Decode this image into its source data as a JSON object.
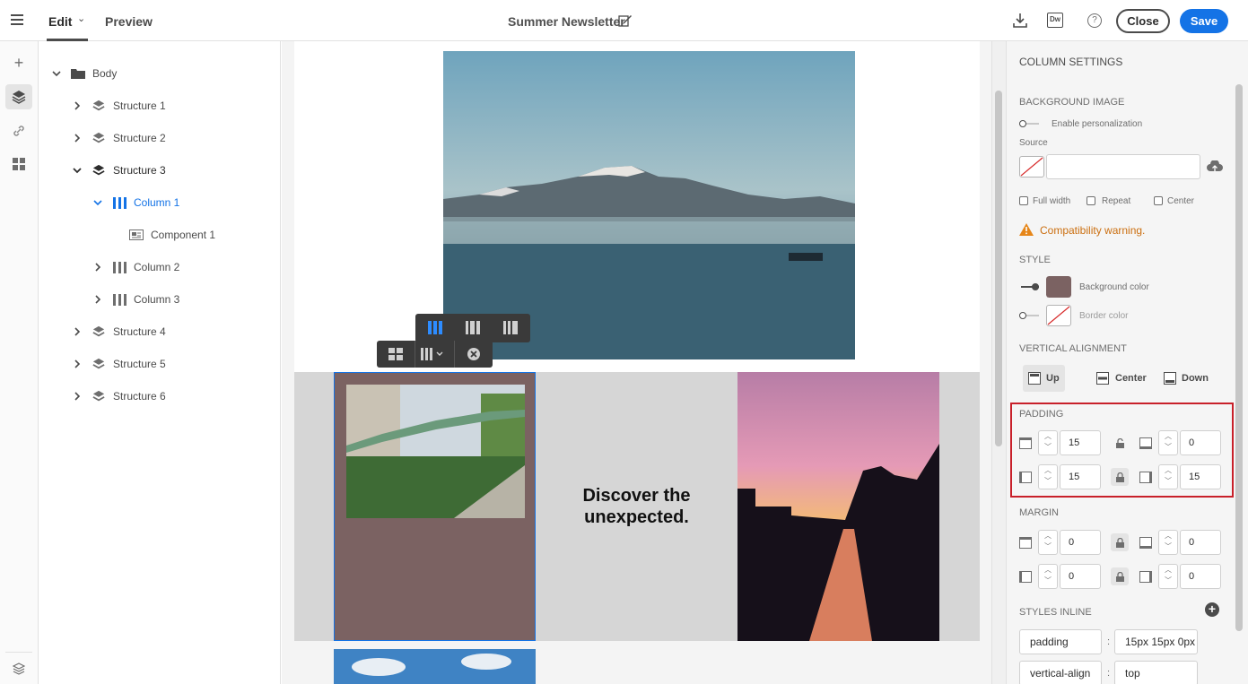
{
  "header": {
    "tabs": [
      {
        "label": "Edit"
      },
      {
        "label": "Preview"
      }
    ],
    "title": "Summer Newsletter",
    "dw_label": "Dw",
    "help_label": "?",
    "close_label": "Close",
    "save_label": "Save"
  },
  "tree": {
    "items": [
      {
        "label": "Body",
        "state": "expanded",
        "icon": "folder-icon"
      },
      {
        "label": "Structure 1",
        "state": "collapsed",
        "icon": "layers-icon"
      },
      {
        "label": "Structure 2",
        "state": "collapsed",
        "icon": "layers-icon"
      },
      {
        "label": "Structure 3",
        "state": "expanded",
        "icon": "layers-icon"
      },
      {
        "label": "Column 1",
        "state": "expanded",
        "icon": "columns-icon",
        "selected": true
      },
      {
        "label": "Component 1",
        "state": "leaf",
        "icon": "component-icon"
      },
      {
        "label": "Column 2",
        "state": "collapsed",
        "icon": "columns-icon"
      },
      {
        "label": "Column 3",
        "state": "collapsed",
        "icon": "columns-icon"
      },
      {
        "label": "Structure 4",
        "state": "collapsed",
        "icon": "layers-icon"
      },
      {
        "label": "Structure 5",
        "state": "collapsed",
        "icon": "layers-icon"
      },
      {
        "label": "Structure 6",
        "state": "collapsed",
        "icon": "layers-icon"
      }
    ]
  },
  "canvas": {
    "headline_line1": "Discover the",
    "headline_line2": "unexpected.",
    "column_bg_color": "#7b6262",
    "structure_bg_color": "#d6d6d6"
  },
  "panel": {
    "title": "COLUMN SETTINGS",
    "background_image": {
      "heading": "BACKGROUND IMAGE",
      "personalization_label": "Enable personalization",
      "source_label": "Source",
      "source_value": "",
      "checkboxes": [
        "Full width",
        "Repeat",
        "Center"
      ],
      "warning": "Compatibility warning."
    },
    "style": {
      "heading": "STYLE",
      "background_color_label": "Background color",
      "background_color": "#7b6262",
      "border_color_label": "Border color"
    },
    "vertical_alignment": {
      "heading": "VERTICAL ALIGNMENT",
      "options": [
        "Up",
        "Center",
        "Down"
      ],
      "selected": "Up"
    },
    "padding": {
      "heading": "PADDING",
      "top": "15",
      "bottom": "0",
      "left": "15",
      "right": "15"
    },
    "margin": {
      "heading": "MARGIN",
      "top": "0",
      "bottom": "0",
      "left": "0",
      "right": "0"
    },
    "styles_inline": {
      "heading": "STYLES INLINE",
      "rows": [
        {
          "key": "padding",
          "value": "15px 15px 0px"
        },
        {
          "key": "vertical-align",
          "value": "top"
        }
      ]
    }
  },
  "colors": {
    "accent": "#1473e6",
    "warning": "#cb6f10",
    "highlight": "#c8202a"
  }
}
